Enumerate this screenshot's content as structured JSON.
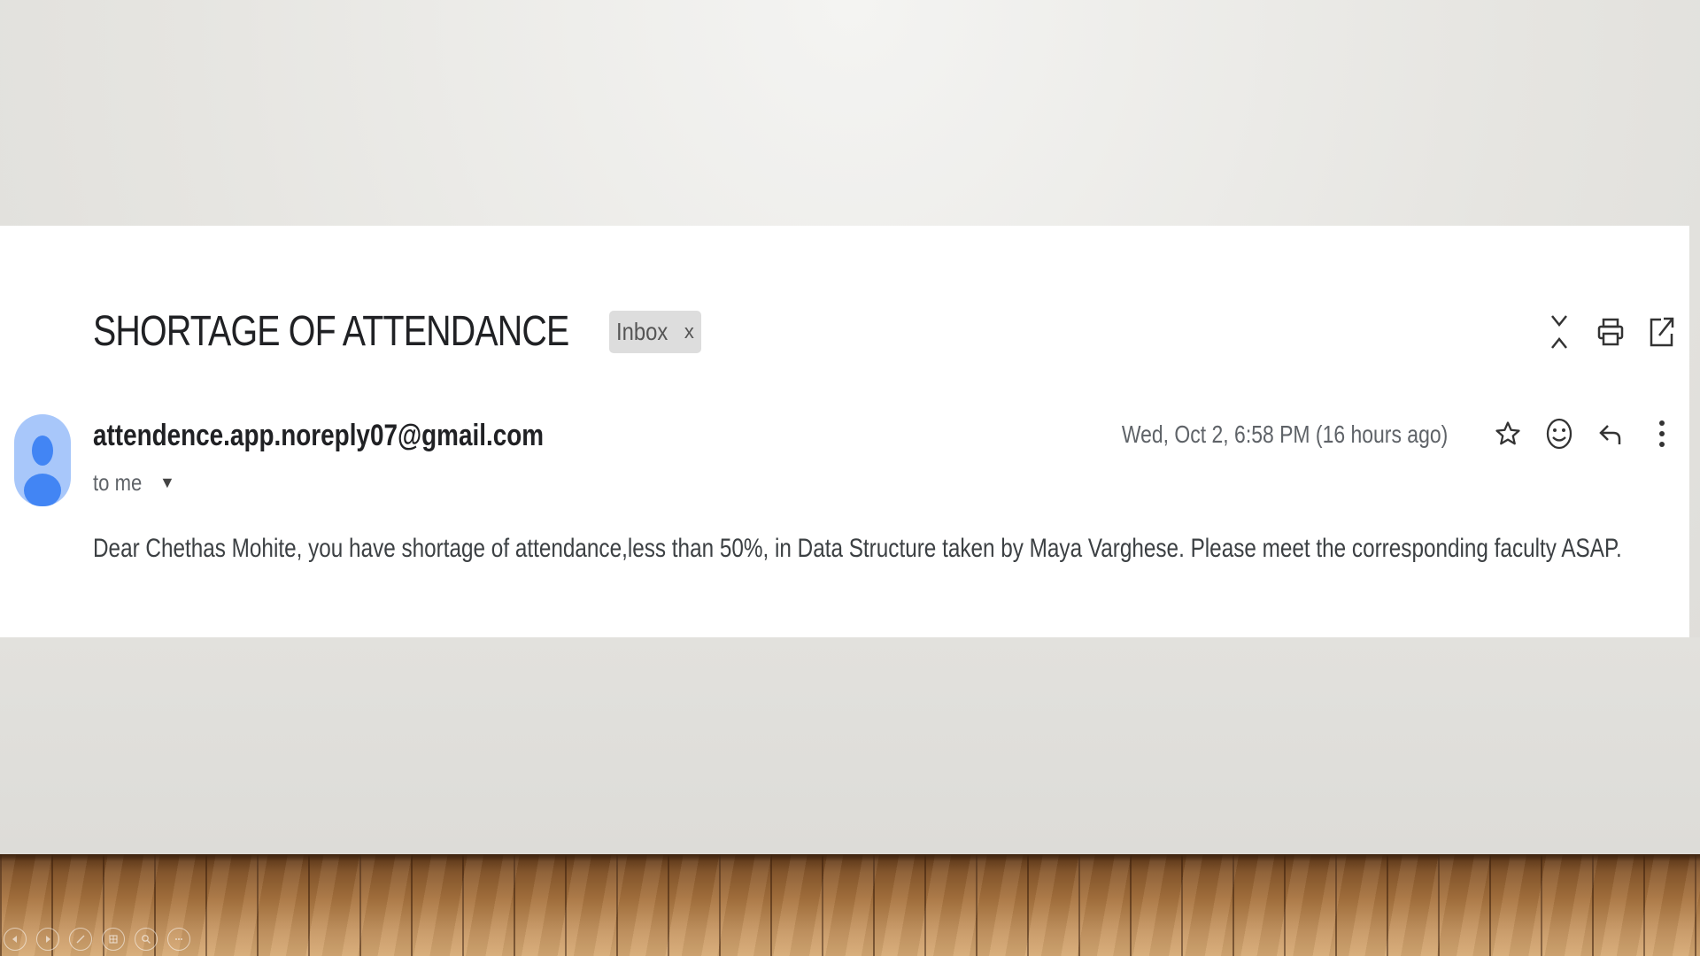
{
  "email": {
    "subject": "SHORTAGE OF ATTENDANCE",
    "label": "Inbox",
    "label_close": "x",
    "sender": "attendence.app.noreply07@gmail.com",
    "recipient": "to me",
    "timestamp": "Wed, Oct 2, 6:58 PM (16 hours ago)",
    "body": "Dear Chethas Mohite, you have shortage of attendance,less than 50%, in Data Structure  taken by Maya Varghese. Please meet the corresponding faculty ASAP."
  },
  "icons": {
    "expand_collapse": "expand-collapse-icon",
    "print": "print-icon",
    "open_new_window": "open-in-new-window-icon",
    "star": "star-icon",
    "emoji": "emoji-reaction-icon",
    "reply": "reply-icon",
    "more": "more-vert-icon"
  },
  "colors": {
    "avatar_bg": "#a8c7fa",
    "avatar_fg": "#4285f4",
    "chip_bg": "#dddddd"
  }
}
